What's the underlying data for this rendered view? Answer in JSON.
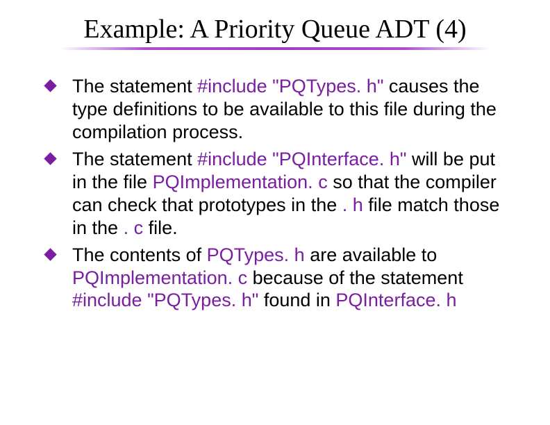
{
  "title": "Example: A Priority Queue ADT (4)",
  "bullets": [
    {
      "t0": "The statement ",
      "h0": "#include \"PQTypes. h\"",
      "t1": " causes the type definitions to be available to this file during the compilation process."
    },
    {
      "t0": "The statement ",
      "h0": "#include \"PQInterface. h\"",
      "t1": " will be put in the file ",
      "h1": "PQImplementation. c",
      "t2": " so that the compiler can check that prototypes in the ",
      "h2": ". h",
      "t3": " file match those in the ",
      "h3": ". c",
      "t4": " file."
    },
    {
      "t0": "The contents of ",
      "h0": "PQTypes. h",
      "t1": " are available to ",
      "h1": "PQImplementation. c",
      "t2": " because of the statement ",
      "h2": "#include \"PQTypes. h\"",
      "t3": " found in ",
      "h3": "PQInterface. h"
    }
  ]
}
